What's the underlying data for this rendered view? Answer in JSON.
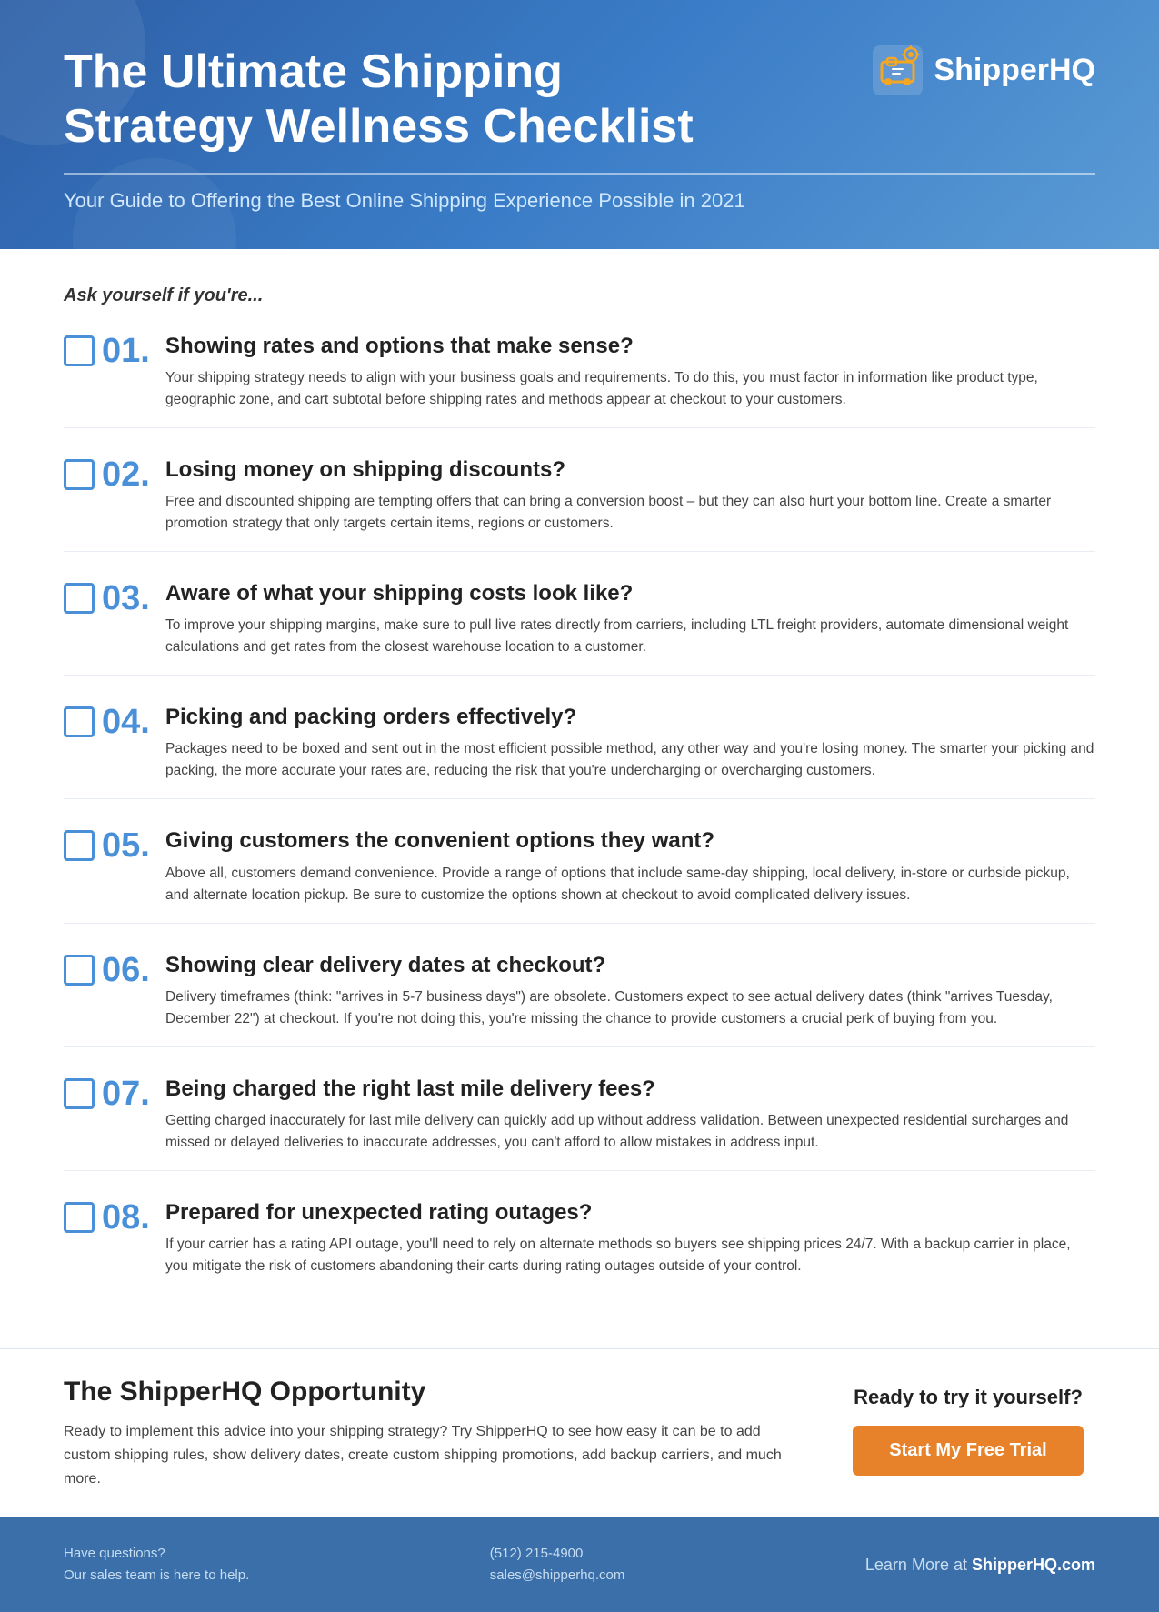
{
  "header": {
    "title": "The Ultimate Shipping Strategy Wellness Checklist",
    "subtitle": "Your Guide to Offering the Best Online Shipping Experience Possible in 2021",
    "logo_text": "ShipperHQ"
  },
  "main": {
    "ask_label": "Ask yourself if you're...",
    "checklist": [
      {
        "number": "01.",
        "title": "Showing rates and options that make sense?",
        "desc": "Your shipping strategy needs to align with your business goals and requirements. To do this, you must factor in information like product type, geographic zone, and cart subtotal before shipping rates and methods appear at checkout to your customers."
      },
      {
        "number": "02.",
        "title": "Losing money on shipping discounts?",
        "desc": "Free and discounted shipping are tempting offers that can bring a conversion boost – but they can also hurt your bottom line. Create a smarter promotion strategy that only targets certain items, regions or customers."
      },
      {
        "number": "03.",
        "title": "Aware of what your shipping costs look like?",
        "desc": "To improve your shipping margins, make sure to pull live rates directly from carriers, including LTL freight providers, automate dimensional weight calculations and get rates from the closest warehouse location to a customer."
      },
      {
        "number": "04.",
        "title": "Picking and packing orders effectively?",
        "desc": "Packages need to be boxed and sent out in the most efficient possible method, any other way and you're losing money. The smarter your picking and packing, the more accurate your rates are, reducing the risk that you're undercharging or overcharging customers."
      },
      {
        "number": "05.",
        "title": "Giving customers the convenient options they want?",
        "desc": "Above all, customers demand convenience. Provide a range of options that include same-day shipping, local delivery, in-store or curbside pickup, and alternate location pickup. Be sure to customize the options shown at checkout to avoid complicated delivery issues."
      },
      {
        "number": "06.",
        "title": "Showing clear delivery dates at checkout?",
        "desc": "Delivery timeframes (think: \"arrives in 5-7 business days\") are obsolete. Customers expect to see actual delivery dates (think \"arrives Tuesday, December 22\") at checkout. If you're not doing this, you're missing the chance to provide customers a crucial perk of buying from you."
      },
      {
        "number": "07.",
        "title": "Being charged the right last mile delivery fees?",
        "desc": "Getting charged inaccurately for last mile delivery can quickly add up without address validation. Between unexpected residential surcharges and missed or delayed deliveries to inaccurate addresses, you can't afford to allow mistakes in address input."
      },
      {
        "number": "08.",
        "title": "Prepared for unexpected rating outages?",
        "desc": "If your carrier has a rating API outage, you'll need to rely on alternate methods so buyers see shipping prices 24/7. With a backup carrier in place, you mitigate the risk of customers abandoning their carts during rating outages outside of your control."
      }
    ]
  },
  "opportunity": {
    "title": "The ShipperHQ Opportunity",
    "desc": "Ready to implement this advice into your shipping strategy? Try ShipperHQ to see how easy it can be to add custom shipping rules, show delivery dates, create custom shipping promotions, add backup carriers, and much more.",
    "cta_label": "Ready to try it yourself?",
    "btn_label": "Start My Free Trial"
  },
  "footer": {
    "have_questions": "Have questions?",
    "sales_team": "Our sales team is here to help.",
    "phone": "(512) 215-4900",
    "email": "sales@shipperhq.com",
    "learn_more_prefix": "Learn More at ",
    "learn_more_link": "ShipperHQ.com"
  }
}
